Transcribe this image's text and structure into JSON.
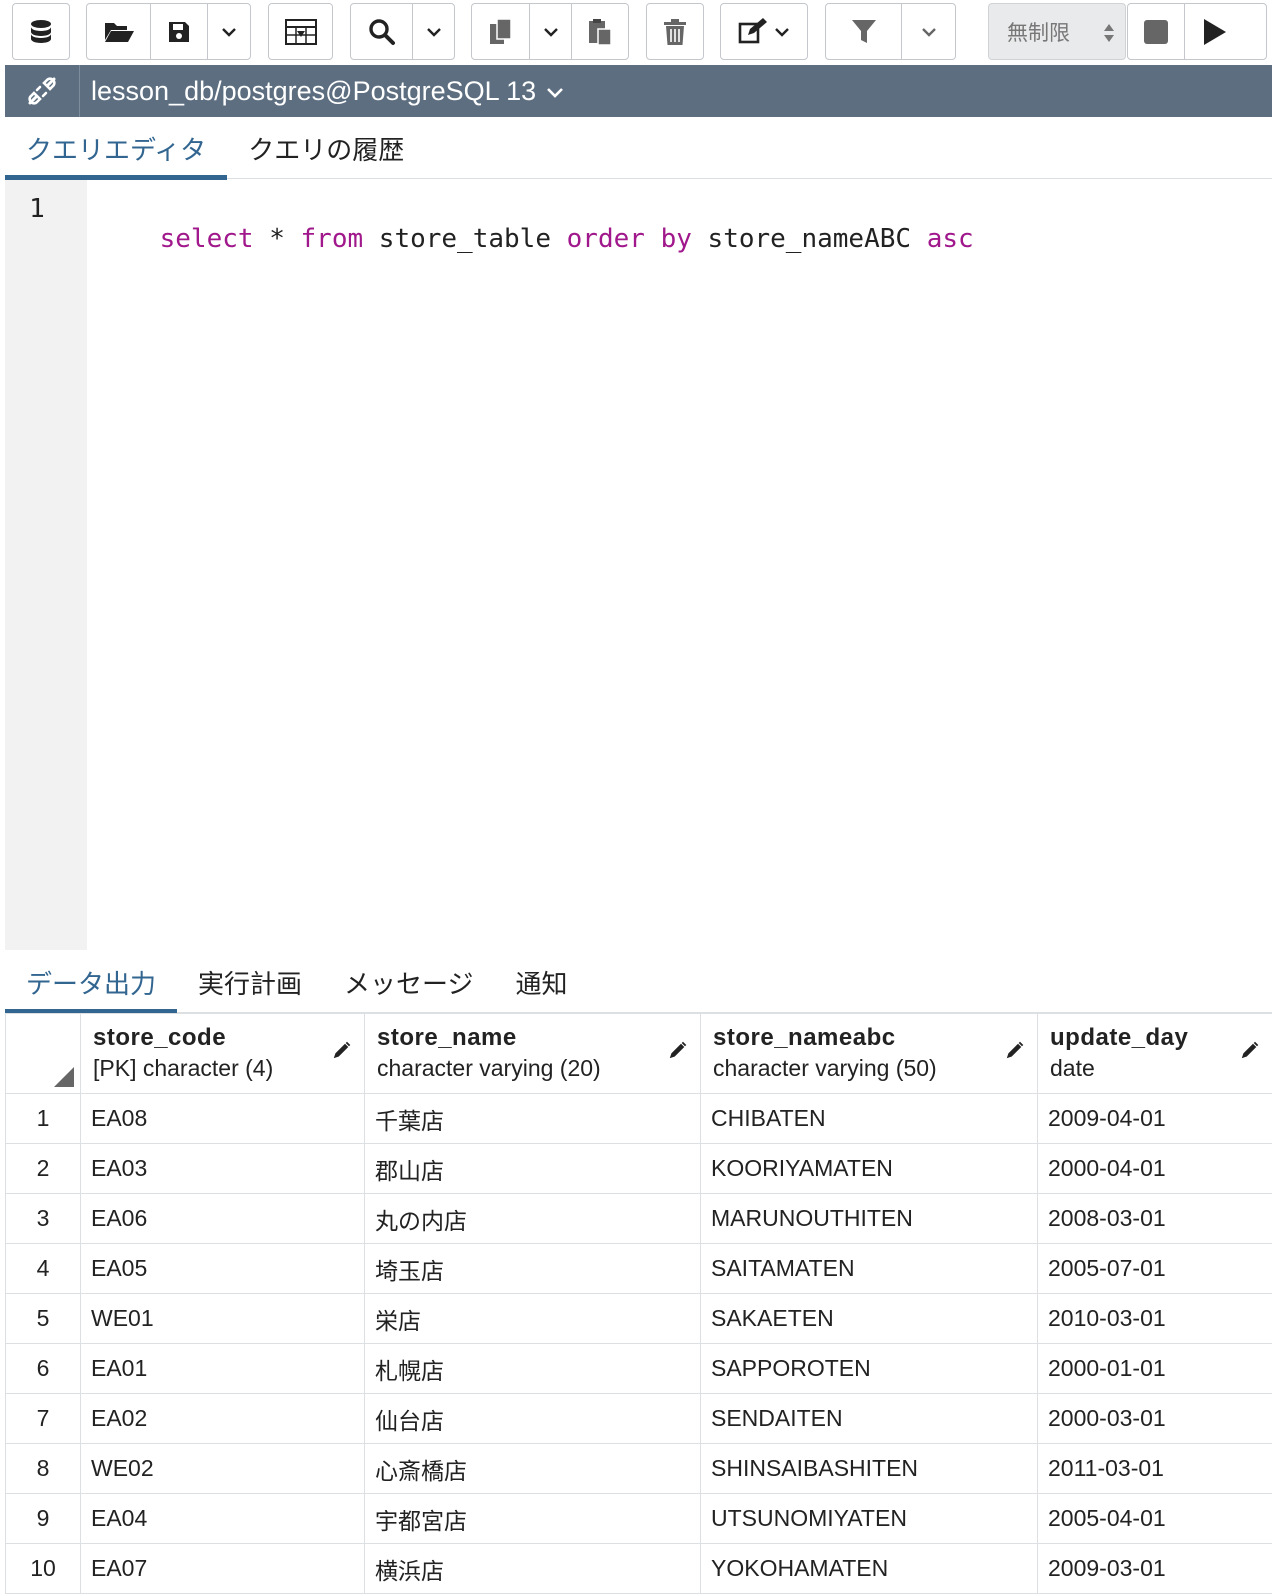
{
  "toolbar": {
    "limit_select_value": "無制限"
  },
  "connection": {
    "title": "lesson_db/postgres@PostgreSQL 13"
  },
  "editor_tabs": [
    {
      "label": "クエリエディタ",
      "active": true
    },
    {
      "label": "クエリの履歴",
      "active": false
    }
  ],
  "editor": {
    "line_number": "1",
    "tokens": [
      {
        "text": "select",
        "kind": "keyword"
      },
      {
        "text": " * ",
        "kind": "plain"
      },
      {
        "text": "from",
        "kind": "keyword"
      },
      {
        "text": " store_table ",
        "kind": "plain"
      },
      {
        "text": "order",
        "kind": "keyword"
      },
      {
        "text": " ",
        "kind": "plain"
      },
      {
        "text": "by",
        "kind": "keyword"
      },
      {
        "text": " store_nameABC ",
        "kind": "plain"
      },
      {
        "text": "asc",
        "kind": "keyword"
      }
    ],
    "keyword_color": "#a0188b"
  },
  "output_tabs": [
    {
      "label": "データ出力",
      "active": true
    },
    {
      "label": "実行計画",
      "active": false
    },
    {
      "label": "メッセージ",
      "active": false
    },
    {
      "label": "通知",
      "active": false
    }
  ],
  "grid": {
    "columns": [
      {
        "name": "store_code",
        "type": "[PK] character (4)"
      },
      {
        "name": "store_name",
        "type": "character varying (20)"
      },
      {
        "name": "store_nameabc",
        "type": "character varying (50)"
      },
      {
        "name": "update_day",
        "type": "date"
      }
    ],
    "rows": [
      {
        "n": "1",
        "cells": [
          "EA08",
          "千葉店",
          "CHIBATEN",
          "2009-04-01"
        ]
      },
      {
        "n": "2",
        "cells": [
          "EA03",
          "郡山店",
          "KOORIYAMATEN",
          "2000-04-01"
        ]
      },
      {
        "n": "3",
        "cells": [
          "EA06",
          "丸の内店",
          "MARUNOUTHITEN",
          "2008-03-01"
        ]
      },
      {
        "n": "4",
        "cells": [
          "EA05",
          "埼玉店",
          "SAITAMATEN",
          "2005-07-01"
        ]
      },
      {
        "n": "5",
        "cells": [
          "WE01",
          "栄店",
          "SAKAETEN",
          "2010-03-01"
        ]
      },
      {
        "n": "6",
        "cells": [
          "EA01",
          "札幌店",
          "SAPPOROTEN",
          "2000-01-01"
        ]
      },
      {
        "n": "7",
        "cells": [
          "EA02",
          "仙台店",
          "SENDAITEN",
          "2000-03-01"
        ]
      },
      {
        "n": "8",
        "cells": [
          "WE02",
          "心斎橋店",
          "SHINSAIBASHITEN",
          "2011-03-01"
        ]
      },
      {
        "n": "9",
        "cells": [
          "EA04",
          "宇都宮店",
          "UTSUNOMIYATEN",
          "2005-04-01"
        ]
      },
      {
        "n": "10",
        "cells": [
          "EA07",
          "横浜店",
          "YOKOHAMATEN",
          "2009-03-01"
        ]
      }
    ]
  },
  "colors": {
    "accent": "#326690",
    "connection_bar": "#5c6e80"
  },
  "icons": [
    "database-icon",
    "folder-open-icon",
    "save-icon",
    "chevron-down-icon",
    "download-table-icon",
    "search-icon",
    "copy-icon",
    "paste-icon",
    "delete-icon",
    "edit-icon",
    "filter-icon",
    "stop-icon",
    "play-icon",
    "disconnected-plug-icon",
    "pencil-icon"
  ]
}
